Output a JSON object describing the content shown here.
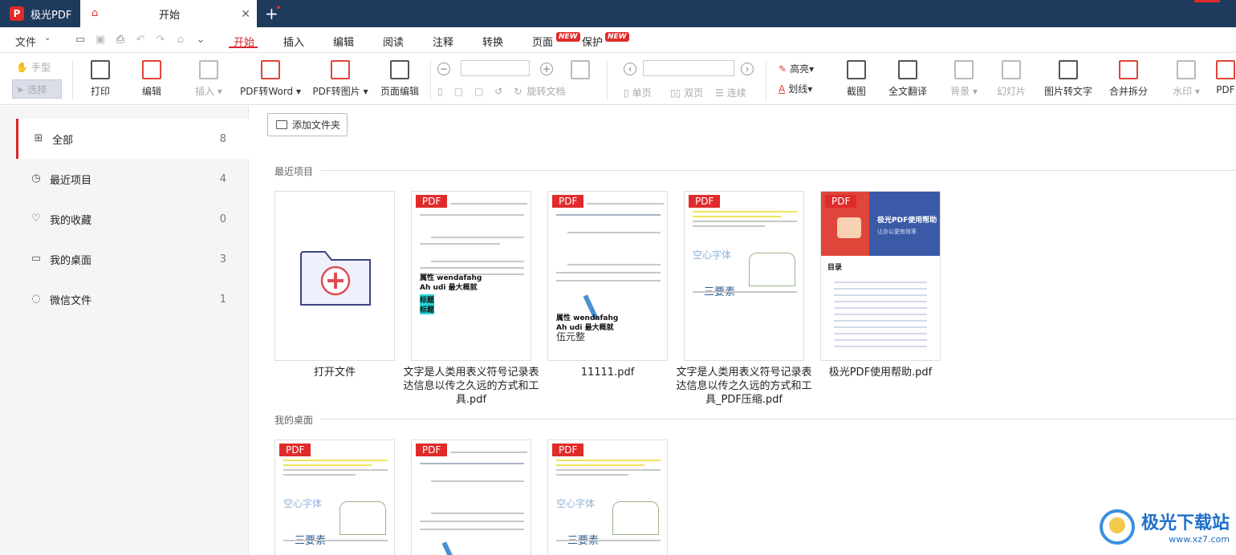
{
  "titlebar": {
    "app_name": "极光PDF",
    "app_logo": "P",
    "tab_label": "开始"
  },
  "menubar": {
    "file": "文件",
    "items": [
      "开始",
      "插入",
      "编辑",
      "阅读",
      "注释",
      "转换",
      "页面",
      "保护"
    ],
    "new_badge": "NEW"
  },
  "ribbon": {
    "hand": "手型",
    "select": "选择",
    "print": "打印",
    "edit": "编辑",
    "insert": "插入",
    "pdf_to_word": "PDF转Word",
    "pdf_to_image": "PDF转图片",
    "page_edit": "页面编辑",
    "rotate_doc": "旋转文档",
    "single_page": "单页",
    "double_page": "双页",
    "continuous": "连续",
    "highlight": "高亮",
    "underline": "划线",
    "screenshot": "截图",
    "full_translate": "全文翻译",
    "background": "背景",
    "slideshow": "幻灯片",
    "image_to_text": "图片转文字",
    "merge_split": "合并拆分",
    "watermark": "水印",
    "pdf_cut": "PDF"
  },
  "sidebar": {
    "items": [
      {
        "label": "全部",
        "count": "8"
      },
      {
        "label": "最近项目",
        "count": "4"
      },
      {
        "label": "我的收藏",
        "count": "0"
      },
      {
        "label": "我的桌面",
        "count": "3"
      },
      {
        "label": "微信文件",
        "count": "1"
      }
    ]
  },
  "content": {
    "add_folder": "添加文件夹",
    "recent_label": "最近项目",
    "desktop_label": "我的桌面",
    "pdf_tag": "PDF",
    "recent": [
      {
        "name": "打开文件"
      },
      {
        "name": "文字是人类用表义符号记录表达信息以传之久远的方式和工具.pdf"
      },
      {
        "name": "11111.pdf"
      },
      {
        "name": "文字是人类用表义符号记录表达信息以传之久远的方式和工具_PDF压缩.pdf"
      },
      {
        "name": "极光PDF使用帮助.pdf"
      }
    ],
    "preview": {
      "shuxing": "属性 wendafahg",
      "ahudi": "Ah udi 最大概就",
      "biaoti": "标题",
      "kongxin": "空心字体",
      "sanyaosu": "三要素",
      "wuyuan": "伍元整",
      "help_title": "极光PDF使用帮助",
      "help_sub": "让办公更有效率",
      "mulu": "目录"
    }
  },
  "watermark": {
    "name": "极光下载站",
    "url": "www.xz7.com"
  }
}
